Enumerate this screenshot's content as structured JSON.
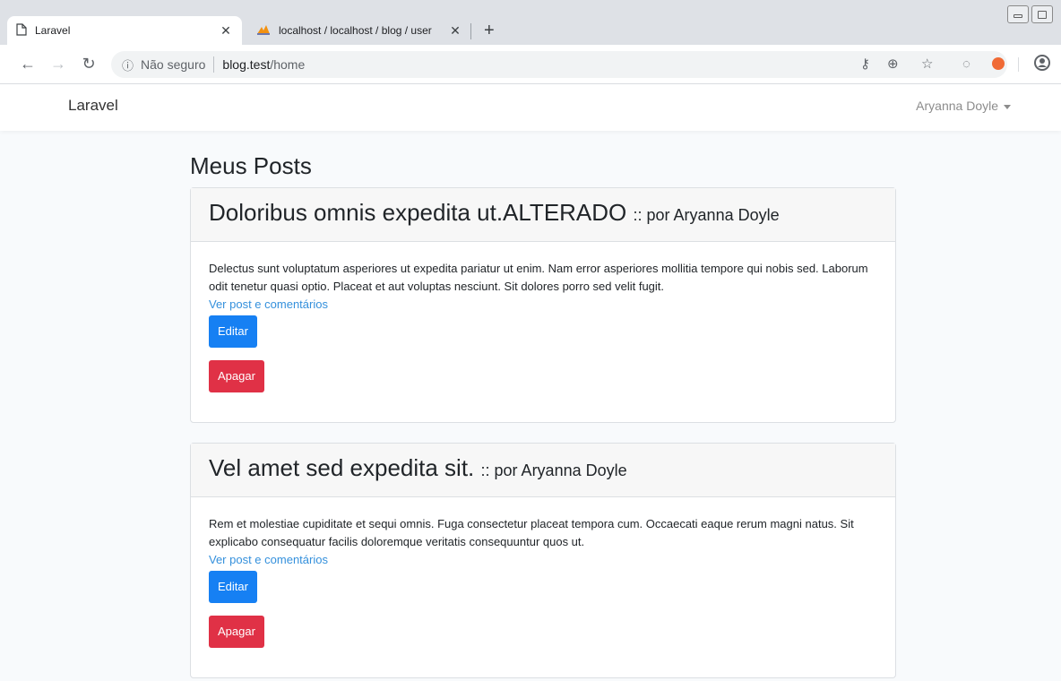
{
  "browser": {
    "tabs": [
      {
        "title": "Laravel",
        "active": true
      },
      {
        "title": "localhost / localhost / blog / user",
        "active": false
      }
    ],
    "new_tab": "+",
    "security_label": "Não seguro",
    "url_host": "blog.test",
    "url_path": "/home"
  },
  "app": {
    "brand": "Laravel",
    "user_name": "Aryanna Doyle"
  },
  "page_title": "Meus Posts",
  "posts": [
    {
      "title": "Doloribus omnis expedita ut.ALTERADO",
      "byline": ":: por Aryanna Doyle",
      "body": "Delectus sunt voluptatum asperiores ut expedita pariatur ut enim. Nam error asperiores mollitia tempore qui nobis sed. Laborum odit tenetur quasi optio. Placeat et aut voluptas nesciunt. Sit dolores porro sed velit fugit.",
      "link": "Ver post e comentários",
      "edit_label": "Editar",
      "delete_label": "Apagar"
    },
    {
      "title": "Vel amet sed expedita sit.",
      "byline": ":: por Aryanna Doyle",
      "body": "Rem et molestiae cupiditate et sequi omnis. Fuga consectetur placeat tempora cum. Occaecati eaque rerum magni natus. Sit explicabo consequatur facilis doloremque veritatis consequuntur quos ut.",
      "link": "Ver post e comentários",
      "edit_label": "Editar",
      "delete_label": "Apagar"
    }
  ],
  "colors": {
    "primary_button": "#1680f3",
    "danger_button": "#e03146",
    "link": "#3490dc"
  }
}
